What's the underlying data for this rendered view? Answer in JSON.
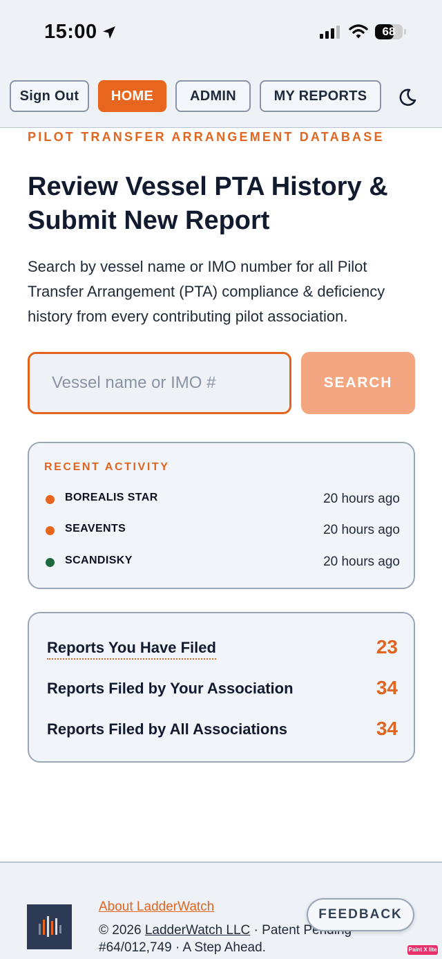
{
  "status_bar": {
    "time": "15:00",
    "battery": "68",
    "battery_fraction": 0.68
  },
  "nav": {
    "sign_out": "Sign Out",
    "home": "HOME",
    "admin": "ADMIN",
    "my_reports": "MY REPORTS",
    "theme_icon": "moon-icon"
  },
  "hero": {
    "eyebrow": "PILOT TRANSFER ARRANGEMENT DATABASE",
    "headline": "Review Vessel PTA History & Submit New Report",
    "intro": "Search by vessel name or IMO number for all Pilot Transfer Arrangement (PTA) compliance & deficiency history from every contributing pilot association."
  },
  "search": {
    "placeholder": "Vessel name or IMO #",
    "value": "",
    "button": "SEARCH"
  },
  "recent_activity": {
    "title": "RECENT ACTIVITY",
    "items": [
      {
        "vessel": "BOREALIS STAR",
        "time": "20 hours ago",
        "status_color": "#e8651d"
      },
      {
        "vessel": "SEAVENTS",
        "time": "20 hours ago",
        "status_color": "#e8651d"
      },
      {
        "vessel": "SCANDISKY",
        "time": "20 hours ago",
        "status_color": "#1e6a3c"
      }
    ]
  },
  "stats": [
    {
      "label": "Reports You Have Filed",
      "value": "23"
    },
    {
      "label": "Reports Filed by Your Association",
      "value": "34"
    },
    {
      "label": "Reports Filed by All Associations",
      "value": "34"
    }
  ],
  "footer": {
    "about": "About LadderWatch",
    "copyright_prefix": "© 2026",
    "company": "LadderWatch LLC",
    "legal_rest": "· Patent Pending #64/012,749 · A Step Ahead.",
    "feedback": "FEEDBACK"
  },
  "overlay_stamp": "Paint X lite",
  "colors": {
    "accent": "#e8651d",
    "accent_soft": "#f3a680",
    "ink": "#111a2e",
    "success": "#1e6a3c"
  }
}
